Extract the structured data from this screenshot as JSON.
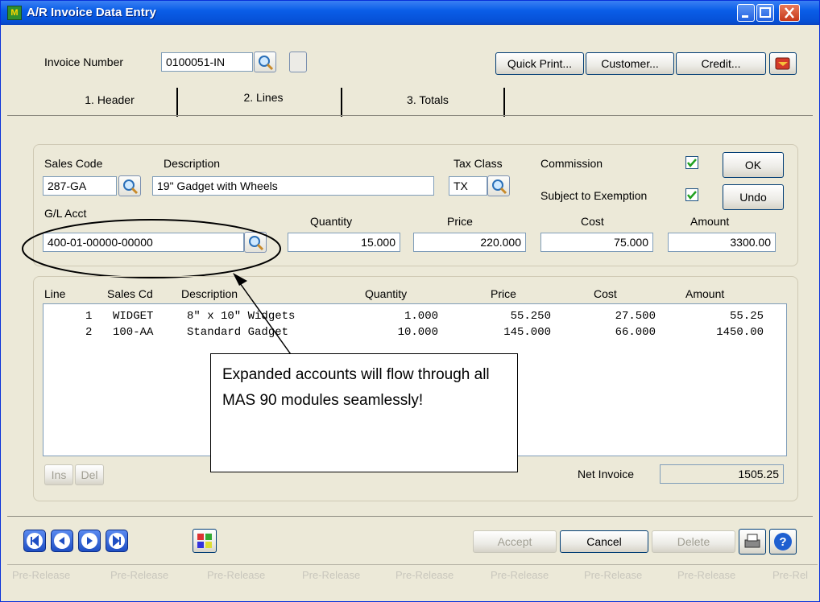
{
  "window": {
    "title": "A/R Invoice Data Entry",
    "app_icon_glyph": "M"
  },
  "invoice": {
    "label": "Invoice Number",
    "value": "0100051-IN"
  },
  "toolbar": {
    "quick_print": "Quick Print...",
    "customer": "Customer...",
    "credit": "Credit..."
  },
  "tabs": [
    {
      "label": "1. Header"
    },
    {
      "label": "2. Lines"
    },
    {
      "label": "3. Totals"
    }
  ],
  "entry": {
    "sales_code_label": "Sales Code",
    "sales_code": "287-GA",
    "description_label": "Description",
    "description": "19\" Gadget with Wheels",
    "tax_class_label": "Tax Class",
    "tax_class": "TX",
    "commission_label": "Commission",
    "commission_checked": true,
    "subject_label": "Subject to Exemption",
    "subject_checked": true,
    "gl_label": "G/L Acct",
    "gl_acct": "400-01-00000-00000",
    "quantity_label": "Quantity",
    "quantity": "15.000",
    "price_label": "Price",
    "price": "220.000",
    "cost_label": "Cost",
    "cost": "75.000",
    "amount_label": "Amount",
    "amount": "3300.00",
    "ok": "OK",
    "undo": "Undo"
  },
  "grid": {
    "headers": [
      "Line",
      "Sales Cd",
      "Description",
      "Quantity",
      "Price",
      "Cost",
      "Amount"
    ],
    "rows": [
      {
        "line": "1",
        "code": "WIDGET",
        "desc": "8\" x 10\" Widgets",
        "qty": "1.000",
        "price": "55.250",
        "cost": "27.500",
        "amount": "55.25"
      },
      {
        "line": "2",
        "code": "100-AA",
        "desc": "Standard Gadget",
        "qty": "10.000",
        "price": "145.000",
        "cost": "66.000",
        "amount": "1450.00"
      }
    ],
    "ins": "Ins",
    "del": "Del",
    "net_invoice_label": "Net Invoice",
    "net_invoice": "1505.25"
  },
  "callout": {
    "text": "Expanded accounts will flow through all MAS 90 modules seamlessly!"
  },
  "footer": {
    "accept": "Accept",
    "cancel": "Cancel",
    "delete": "Delete"
  },
  "statusbar": {
    "items": [
      "Pre-Release",
      "Pre-Release",
      "Pre-Release",
      "Pre-Release",
      "Pre-Release",
      "Pre-Release",
      "Pre-Release",
      "Pre-Release",
      "Pre-Rel"
    ]
  }
}
